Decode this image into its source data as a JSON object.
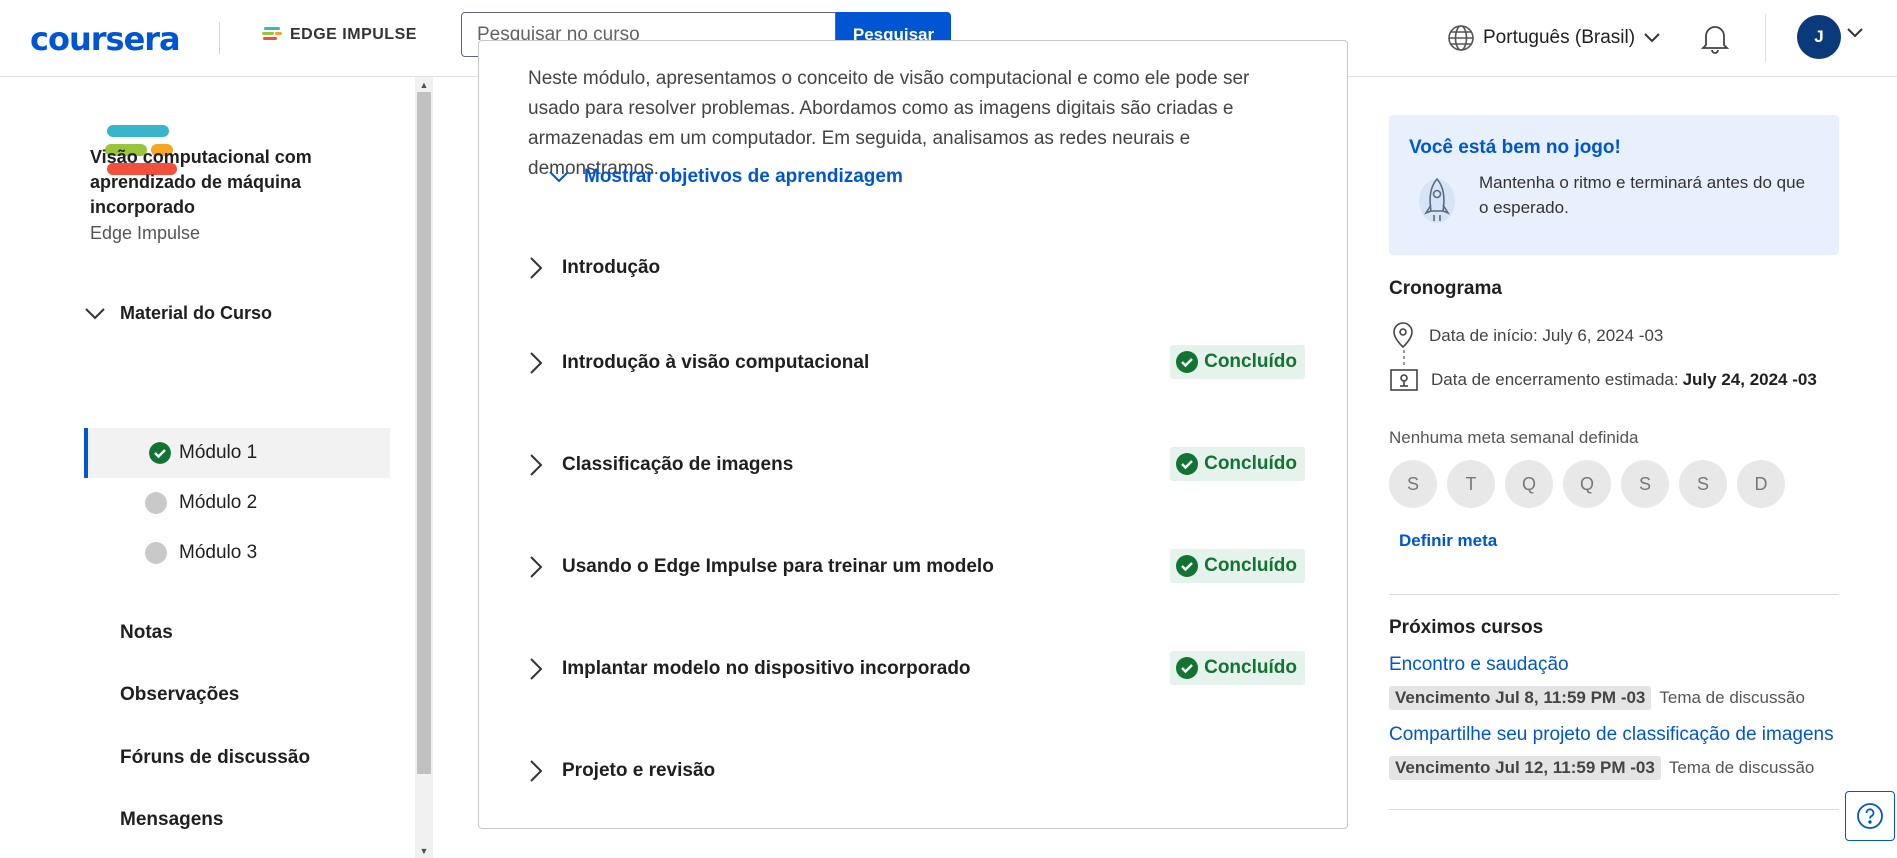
{
  "header": {
    "brand": "coursera",
    "partner_name": "EDGE IMPULSE",
    "search_placeholder": "Pesquisar no curso",
    "search_button": "Pesquisar",
    "language": "Português (Brasil)",
    "avatar_initial": "J"
  },
  "sidebar": {
    "course_title": "Visão computacional com aprendizado de máquina incorporado",
    "course_partner": "Edge Impulse",
    "material_label": "Material do Curso",
    "modules": [
      {
        "label": "Módulo 1",
        "status": "completed"
      },
      {
        "label": "Módulo 2",
        "status": "pending"
      },
      {
        "label": "Módulo 3",
        "status": "pending"
      }
    ],
    "links": [
      "Notas",
      "Observações",
      "Fóruns de discussão",
      "Mensagens"
    ]
  },
  "main": {
    "description": "Neste módulo, apresentamos o conceito de visão computacional e como ele pode ser usado para resolver problemas. Abordamos como as imagens digitais são criadas e armazenadas em um computador. Em seguida, analisamos as redes neurais e demonstramos...",
    "objectives_label": "Mostrar objetivos de aprendizagem",
    "lessons": [
      {
        "title": "Introdução",
        "status": ""
      },
      {
        "title": "Introdução à visão computacional",
        "status": "Concluído"
      },
      {
        "title": "Classificação de imagens",
        "status": "Concluído"
      },
      {
        "title": "Usando o Edge Impulse para treinar um modelo",
        "status": "Concluído"
      },
      {
        "title": "Implantar modelo no dispositivo incorporado",
        "status": "Concluído"
      },
      {
        "title": "Projeto e revisão",
        "status": ""
      }
    ]
  },
  "right": {
    "info_title": "Você está bem no jogo!",
    "info_text": "Mantenha o ritmo e terminará antes do que o esperado.",
    "schedule_title": "Cronograma",
    "start_label": "Data de início: July 6, 2024 -03",
    "end_label": "Data de encerramento estimada:",
    "end_value": "July 24, 2024 -03",
    "goal_text": "Nenhuma meta semanal definida",
    "days": [
      "S",
      "T",
      "Q",
      "Q",
      "S",
      "S",
      "D"
    ],
    "set_goal": "Definir meta",
    "next_title": "Próximos cursos",
    "next_items": [
      {
        "title": "Encontro e saudação",
        "due": "Vencimento Jul 8, 11:59 PM -03",
        "type": "Tema de discussão"
      },
      {
        "title": "Compartilhe seu projeto de classificação de imagens",
        "due": "Vencimento Jul 12, 11:59 PM -03",
        "type": "Tema de discussão"
      }
    ]
  },
  "colors": {
    "brand": "#0056d2",
    "success": "#137333",
    "success_bg": "#e6f2ec",
    "info_bg": "#e8f0fe"
  }
}
